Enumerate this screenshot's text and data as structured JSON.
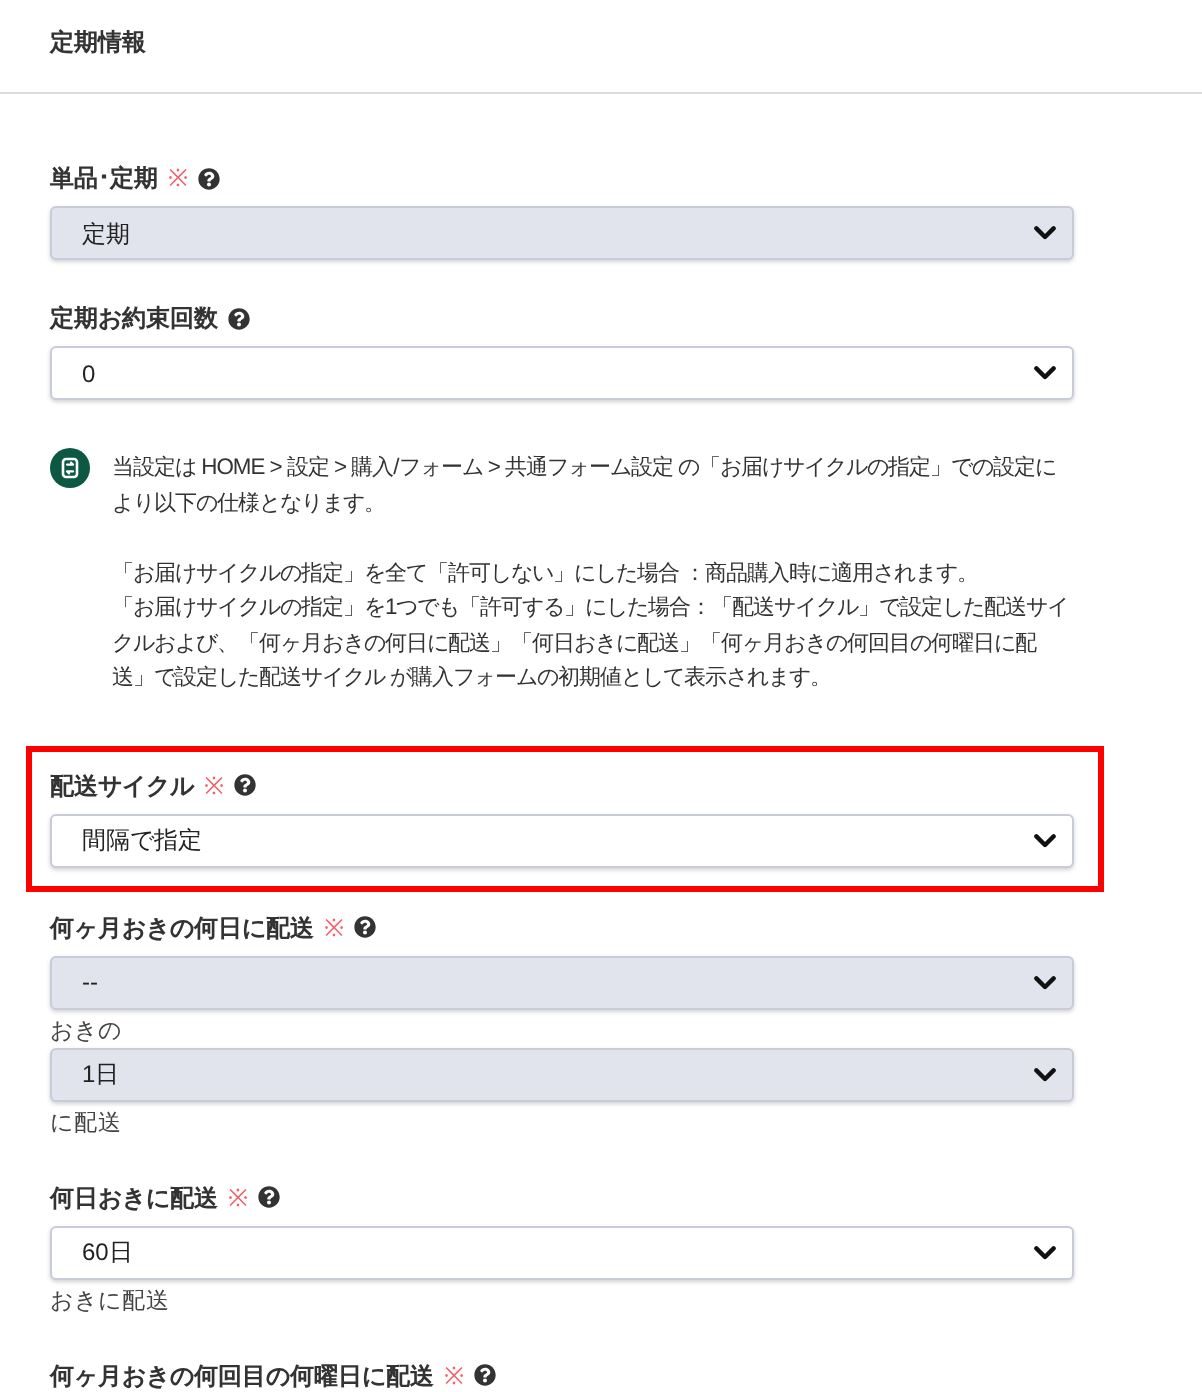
{
  "header": {
    "title": "定期情報"
  },
  "items": [
    {
      "kind": "field",
      "label": "単品･定期",
      "required_mark": "※",
      "highlighted": false,
      "parts": [
        {
          "kind": "select",
          "value": "定期",
          "disabled": true
        }
      ]
    },
    {
      "kind": "field",
      "label": "定期お約束回数",
      "highlighted": false,
      "parts": [
        {
          "kind": "select",
          "value": "0",
          "disabled": false
        }
      ]
    },
    {
      "kind": "notice",
      "paragraphs": [
        [
          "当設定は HOME > 設定 > 購入/フォーム > 共通フォーム設定 の「お届けサイクルの指定」での設定により以下の仕様となります。"
        ],
        [
          "「お届けサイクルの指定」を全て「許可しない」にした場合 ：商品購入時に適用されます。",
          "「お届けサイクルの指定」を1つでも「許可する」にした場合：「配送サイクル」で設定した配送サイクルおよび、「何ヶ月おきの何日に配送」「何日おきに配送」「何ヶ月おきの何回目の何曜日に配送」で設定した配送サイクル が購入フォームの初期値として表示されます。"
        ]
      ]
    },
    {
      "kind": "field",
      "label": "配送サイクル",
      "required_mark": "※",
      "highlighted": true,
      "parts": [
        {
          "kind": "select",
          "value": "間隔で指定",
          "disabled": false
        }
      ]
    },
    {
      "kind": "field",
      "label": "何ヶ月おきの何日に配送",
      "required_mark": "※",
      "highlighted": false,
      "parts": [
        {
          "kind": "select",
          "value": "--",
          "disabled": true
        },
        {
          "kind": "text",
          "text": "おきの"
        },
        {
          "kind": "select",
          "value": "1日",
          "disabled": true
        },
        {
          "kind": "text",
          "text": "に配送"
        }
      ]
    },
    {
      "kind": "field",
      "label": "何日おきに配送",
      "required_mark": "※",
      "highlighted": false,
      "parts": [
        {
          "kind": "select",
          "value": "60日",
          "disabled": false
        },
        {
          "kind": "text",
          "text": "おきに配送"
        }
      ]
    },
    {
      "kind": "field",
      "label": "何ヶ月おきの何回目の何曜日に配送",
      "required_mark": "※",
      "highlighted": false
    }
  ]
}
